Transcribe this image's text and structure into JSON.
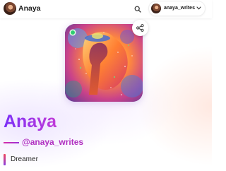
{
  "header": {
    "brand_name": "Anaya",
    "search_icon": "search-icon",
    "account": {
      "username": "anaya_writes",
      "chevron_icon": "chevron-down-icon"
    }
  },
  "hero": {
    "share_icon": "share-icon",
    "online_status": "online-indicator",
    "image_subject": "woman-with-flowing-hair-in-colorful-clouds"
  },
  "profile": {
    "display_name": "Anaya",
    "handle": "@anaya_writes",
    "bio": "Dreamer"
  },
  "colors": {
    "accent_purple": "#7b2ff7",
    "accent_magenta": "#c13bd8",
    "handle_color": "#b02fc0",
    "online_green": "#2ecc71"
  }
}
